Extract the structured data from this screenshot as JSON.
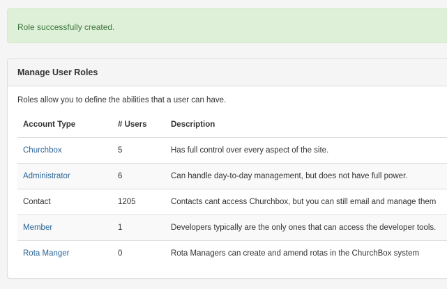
{
  "alert": {
    "message": "Role successfully created."
  },
  "panel": {
    "title": "Manage User Roles",
    "intro": "Roles allow you to define the abilities that a user can have."
  },
  "table": {
    "headers": {
      "account_type": "Account Type",
      "users": "# Users",
      "description": "Description"
    },
    "rows": [
      {
        "account_type": "Churchbox",
        "users": "5",
        "description": "Has full control over every aspect of the site.",
        "linked": true
      },
      {
        "account_type": "Administrator",
        "users": "6",
        "description": "Can handle day-to-day management, but does not have full power.",
        "linked": true
      },
      {
        "account_type": "Contact",
        "users": "1205",
        "description": "Contacts cant access Churchbox, but you can still email and manage them",
        "linked": false
      },
      {
        "account_type": "Member",
        "users": "1",
        "description": "Developers typically are the only ones that can access the developer tools.",
        "linked": true
      },
      {
        "account_type": "Rota Manger",
        "users": "0",
        "description": "Rota Managers can create and amend rotas in the ChurchBox system",
        "linked": true
      }
    ]
  },
  "colors": {
    "link": "#2a6496",
    "alert_bg": "#dff0d8",
    "alert_text": "#3c763d"
  }
}
